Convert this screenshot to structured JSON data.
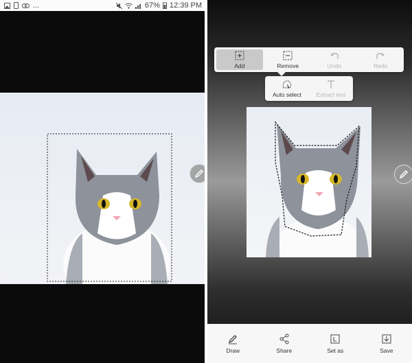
{
  "status_bar": {
    "battery": "67%",
    "time": "12:39 PM",
    "overflow": "..."
  },
  "toolbar": {
    "add_label": "Add",
    "remove_label": "Remove",
    "undo_label": "Undo",
    "redo_label": "Redo"
  },
  "subtoolbar": {
    "auto_select_label": "Auto select",
    "extract_text_label": "Extract text"
  },
  "bottom_bar": {
    "draw_label": "Draw",
    "share_label": "Share",
    "set_as_label": "Set as",
    "save_label": "Save"
  },
  "colors": {
    "active_tool_bg": "#c9c9c9",
    "disabled_text": "#b5b5b5",
    "cat_eye": "#d6b62a"
  }
}
